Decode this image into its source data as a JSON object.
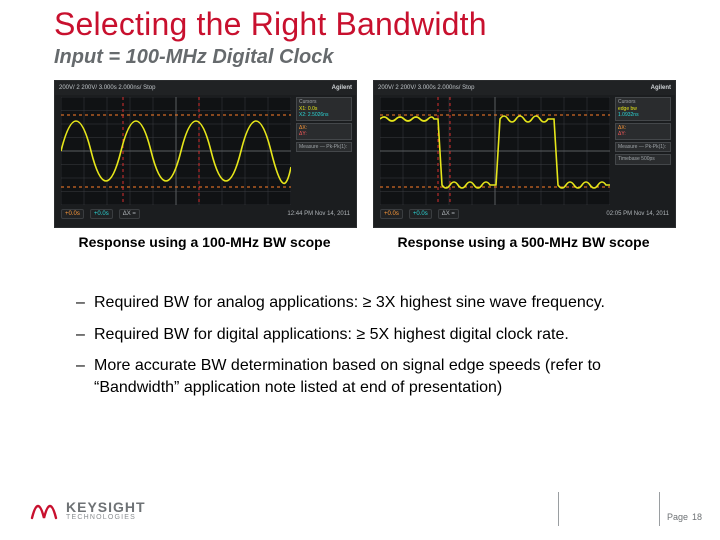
{
  "title": "Selecting the Right Bandwidth",
  "subtitle": "Input = 100-MHz Digital Clock",
  "scopes": {
    "brand": "Agilent",
    "left": {
      "caption": "Response using a 100-MHz BW scope",
      "top_readout": "200V/  2  200V/  3.000s  2.000ns/  Stop",
      "x1": "+0.0s",
      "x2": "+0.0s",
      "dx": "ΔX = ",
      "meas1_lbl": "Cursors",
      "meas1_a": "X1: 0.0s",
      "meas1_b": "X2: 2.5026ns",
      "box2_a": "ΔX:",
      "box2_b": "ΔY:",
      "box3": "Measure — Pk-Pk(1):",
      "timestamp": "12:44 PM  Nov 14, 2011"
    },
    "right": {
      "caption": "Response using a 500-MHz BW scope",
      "top_readout": "200V/  2  200V/  3.000s  2.000ns/  Stop",
      "x1": "+0.0s",
      "x2": "+0.0s",
      "dx": "ΔX = ",
      "meas1_lbl": "Cursors",
      "meas1_a": "edge bw",
      "meas1_b": "1.0932ns",
      "box2_a": "ΔX:",
      "box2_b": "ΔY:",
      "box3": "Measure — Pk-Pk(1):",
      "timestamp": "02:05 PM  Nov 14, 2011",
      "tb": "Timebase  500ps"
    }
  },
  "bullets": [
    "Required BW for analog applications: ≥ 3X highest sine wave frequency.",
    "Required BW for digital applications: ≥ 5X highest digital clock rate.",
    "More accurate BW determination based on signal edge speeds (refer to “Bandwidth” application note listed at end of presentation)"
  ],
  "logo": {
    "name": "KEYSIGHT",
    "tag": "TECHNOLOGIES"
  },
  "page": {
    "label": "Page",
    "number": "18"
  },
  "accent": "#c8102e"
}
